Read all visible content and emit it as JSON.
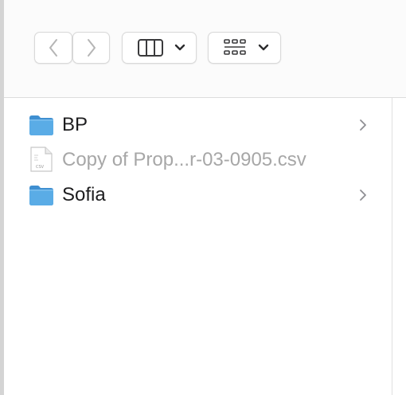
{
  "toolbar": {
    "back_icon": "chevron-left-icon",
    "forward_icon": "chevron-right-icon",
    "view_mode_icon": "columns-view-icon",
    "group_icon": "icon-grid-view-icon",
    "dropdown_icon": "chevron-down-icon"
  },
  "files": [
    {
      "name": "BP",
      "kind": "folder",
      "icon": "folder-icon"
    },
    {
      "name": "Copy of Prop...r-03-0905.csv",
      "kind": "file",
      "icon": "csv-file-icon",
      "icon_label": "CSV"
    },
    {
      "name": "Sofia",
      "kind": "folder",
      "icon": "folder-icon"
    }
  ],
  "colors": {
    "folder": "#5aace6",
    "text": "#1d1d1f",
    "dimmed_text": "#a7a7a7",
    "chevron": "#8e8e93"
  }
}
